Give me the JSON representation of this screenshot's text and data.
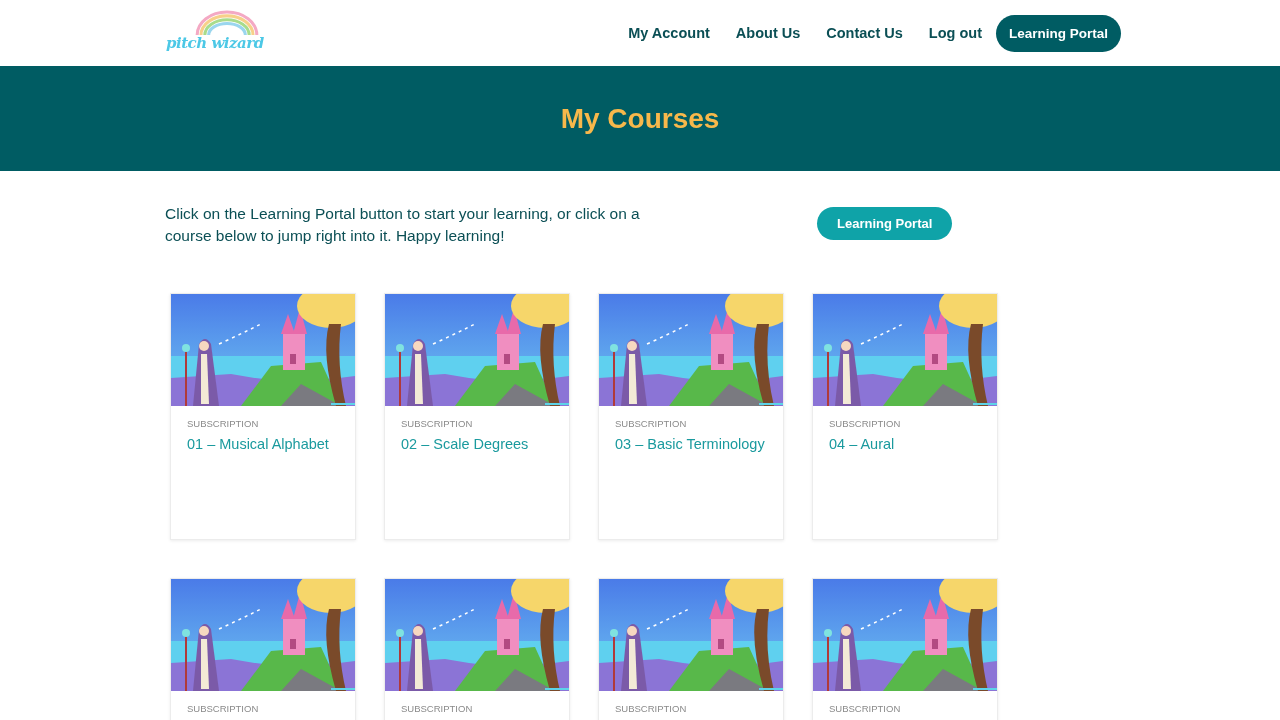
{
  "logo": {
    "text": "pitch wizard"
  },
  "nav": [
    {
      "label": "My Account",
      "kind": "link"
    },
    {
      "label": "About Us",
      "kind": "link"
    },
    {
      "label": "Contact Us",
      "kind": "link"
    },
    {
      "label": "Log out",
      "kind": "link"
    },
    {
      "label": "Learning Portal",
      "kind": "pill"
    }
  ],
  "banner": {
    "title": "My Courses"
  },
  "intro": {
    "text": "Click on the Learning Portal button to start your learning, or click on a course below to jump right into it. Happy learning!",
    "button": "Learning Portal"
  },
  "courses": [
    {
      "category": "SUBSCRIPTION",
      "title": "01 – Musical Alphabet"
    },
    {
      "category": "SUBSCRIPTION",
      "title": "02 – Scale Degrees"
    },
    {
      "category": "SUBSCRIPTION",
      "title": "03 – Basic Terminology"
    },
    {
      "category": "SUBSCRIPTION",
      "title": "04 – Aural"
    },
    {
      "category": "SUBSCRIPTION"
    },
    {
      "category": "SUBSCRIPTION"
    },
    {
      "category": "SUBSCRIPTION"
    },
    {
      "category": "SUBSCRIPTION"
    }
  ]
}
